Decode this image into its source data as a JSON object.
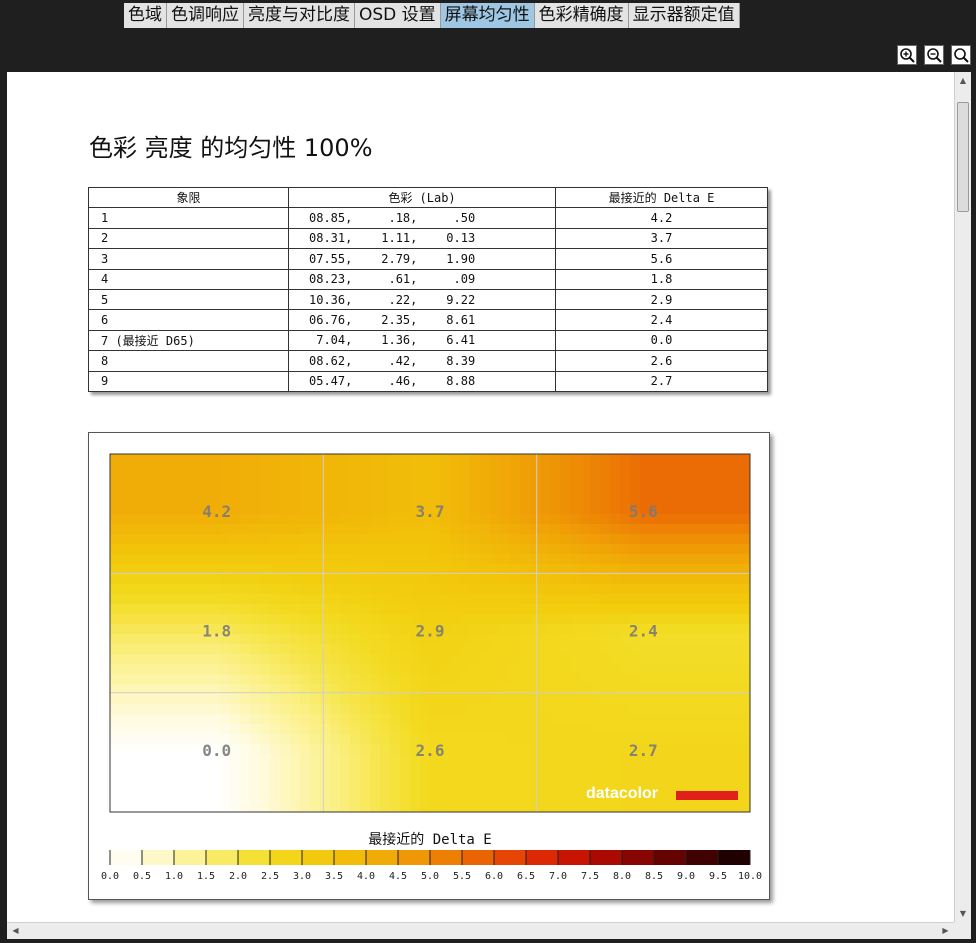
{
  "tabs": [
    {
      "label": "色域",
      "active": false
    },
    {
      "label": "色调响应",
      "active": false
    },
    {
      "label": "亮度与对比度",
      "active": false
    },
    {
      "label": "OSD 设置",
      "active": false
    },
    {
      "label": "屏幕均匀性",
      "active": true
    },
    {
      "label": "色彩精确度",
      "active": false
    },
    {
      "label": "显示器额定值",
      "active": false
    }
  ],
  "zoom_icons": [
    "zoom-in-icon",
    "zoom-out-icon",
    "zoom-fit-icon"
  ],
  "page_title": "色彩 亮度 的均匀性 100%",
  "table": {
    "headers": [
      "象限",
      "色彩 (Lab)",
      "最接近的 Delta E"
    ],
    "rows": [
      {
        "quadrant": "1",
        "lab": "08.85,     .18,     .50",
        "delta_e": "4.2"
      },
      {
        "quadrant": "2",
        "lab": "08.31,    1.11,    0.13",
        "delta_e": "3.7"
      },
      {
        "quadrant": "3",
        "lab": "07.55,    2.79,    1.90",
        "delta_e": "5.6"
      },
      {
        "quadrant": "4",
        "lab": "08.23,     .61,     .09",
        "delta_e": "1.8"
      },
      {
        "quadrant": "5",
        "lab": "10.36,     .22,    9.22",
        "delta_e": "2.9"
      },
      {
        "quadrant": "6",
        "lab": "06.76,    2.35,    8.61",
        "delta_e": "2.4"
      },
      {
        "quadrant": "7 (最接近 D65)",
        "lab": " 7.04,    1.36,    6.41",
        "delta_e": "0.0"
      },
      {
        "quadrant": "8",
        "lab": "08.62,     .42,    8.39",
        "delta_e": "2.6"
      },
      {
        "quadrant": "9",
        "lab": "05.47,     .46,    8.88",
        "delta_e": "2.7"
      }
    ]
  },
  "chart_data": {
    "type": "heatmap",
    "grid": [
      [
        4.2,
        3.7,
        5.6
      ],
      [
        1.8,
        2.9,
        2.4
      ],
      [
        0.0,
        2.6,
        2.7
      ]
    ],
    "cell_labels": [
      "4.2",
      "3.7",
      "5.6",
      "1.8",
      "2.9",
      "2.4",
      "0.0",
      "2.6",
      "2.7"
    ],
    "legend_title": "最接近的 Delta E",
    "scale_min": 0.0,
    "scale_max": 10.0,
    "scale_ticks": [
      "0.0",
      "0.5",
      "1.0",
      "1.5",
      "2.0",
      "2.5",
      "3.0",
      "3.5",
      "4.0",
      "4.5",
      "5.0",
      "5.5",
      "6.0",
      "6.5",
      "7.0",
      "7.5",
      "8.0",
      "8.5",
      "9.0",
      "9.5",
      "10.0"
    ],
    "watermark": "datacolor",
    "colors": {
      "scale": [
        "#ffffff",
        "#fffbe0",
        "#fdf5b0",
        "#fbef80",
        "#f6e54a",
        "#f3db22",
        "#f2cf10",
        "#f2c30a",
        "#f1b408",
        "#f0a206",
        "#ee8c05",
        "#ec7204",
        "#e95504",
        "#e33503",
        "#d41b02",
        "#bb0c01",
        "#990701",
        "#760400",
        "#520200",
        "#2e0100",
        "#0d0000"
      ],
      "watermark_red": "#e0201a"
    }
  }
}
